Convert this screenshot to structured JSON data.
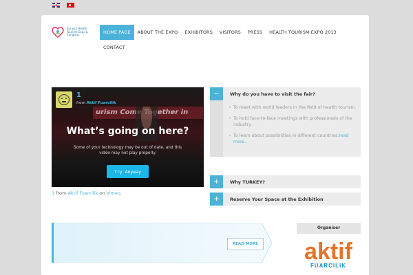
{
  "languages": [
    {
      "name": "English",
      "icon": "flag-uk-icon"
    },
    {
      "name": "Turkish",
      "icon": "flag-tr-icon"
    }
  ],
  "logo": {
    "text": "Eurasia Health Tourism Expo & Congress"
  },
  "nav": {
    "items": [
      {
        "label": "HOME PAGE",
        "active": true
      },
      {
        "label": "ABOUT THE EXPO"
      },
      {
        "label": "EXHIBITORS"
      },
      {
        "label": "VISITORS"
      },
      {
        "label": "PRESS"
      },
      {
        "label": "HEALTH TOURISM EXPO 2013"
      },
      {
        "label": "CONTACT"
      }
    ]
  },
  "video": {
    "title": "1",
    "from_prefix": "from",
    "author": "Aktif Fuarcilik",
    "background_banner": "urism Come Together in",
    "heading": "What’s going on here?",
    "message": "Some of your technology may be out of date, and this video may not play properly.",
    "button": "Try Anyway",
    "caption": {
      "id": "1",
      "from": "from",
      "author": "Aktif Fuarcilik",
      "on": "on",
      "platform": "Vimeo",
      "period": "."
    }
  },
  "accordion": [
    {
      "title": "Why do you have to visit the fair?",
      "toggle": "−",
      "expanded": true,
      "items": [
        "To meet with world leaders in the field of health tourism.",
        "To hold face-to-face meetings with professionals of the industry.",
        "To learn about possibilities in different countries."
      ],
      "more": "read more.."
    },
    {
      "title": "Why TURKEY?",
      "toggle": "+",
      "expanded": false
    },
    {
      "title": "Reserve Your Space at the Exhibition",
      "toggle": "+",
      "expanded": false
    }
  ],
  "cta": {
    "button": "READ MORE"
  },
  "organiser": {
    "label": "Organiser",
    "brand_primary": "aktif",
    "brand_secondary": "FUARCILIK"
  },
  "colors": {
    "accent": "#4bb3d9",
    "brand_orange": "#e8732a",
    "brand_blue": "#1a8fc4"
  }
}
